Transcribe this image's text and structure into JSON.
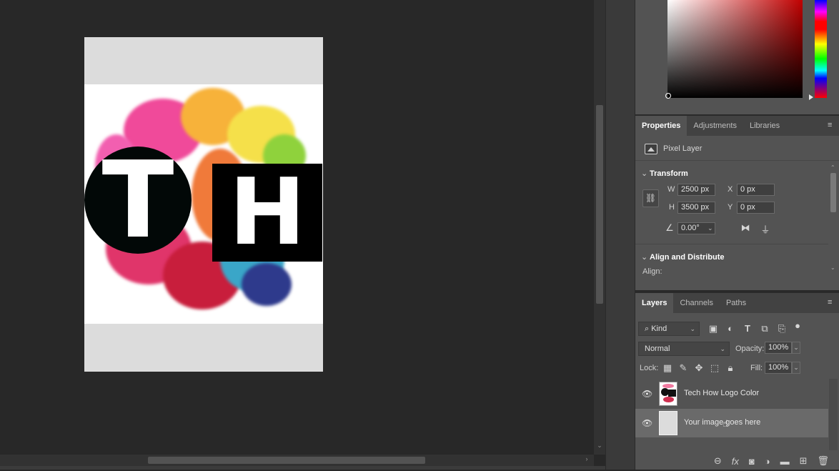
{
  "properties_panel": {
    "tabs": [
      {
        "label": "Properties",
        "active": true
      },
      {
        "label": "Adjustments",
        "active": false
      },
      {
        "label": "Libraries",
        "active": false
      }
    ],
    "layer_type": "Pixel Layer",
    "transform": {
      "title": "Transform",
      "w_label": "W",
      "w_value": "2500 px",
      "h_label": "H",
      "h_value": "3500 px",
      "x_label": "X",
      "x_value": "0 px",
      "y_label": "Y",
      "y_value": "0 px",
      "angle_value": "0.00°"
    },
    "align": {
      "title": "Align and Distribute",
      "align_label": "Align:"
    }
  },
  "layers_panel": {
    "tabs": [
      {
        "label": "Layers",
        "active": true
      },
      {
        "label": "Channels",
        "active": false
      },
      {
        "label": "Paths",
        "active": false
      }
    ],
    "filter_kind": "Kind",
    "blend_mode": "Normal",
    "opacity_label": "Opacity:",
    "opacity_value": "100%",
    "lock_label": "Lock:",
    "fill_label": "Fill:",
    "fill_value": "100%",
    "layers": [
      {
        "name": "Tech How Logo Color",
        "visible": true,
        "selected": false
      },
      {
        "name": "Your image goes here",
        "visible": true,
        "selected": true
      }
    ]
  },
  "document": {
    "logo_letter_left": "T",
    "logo_letter_right": "H"
  },
  "colors": {
    "canvas_bg": "#282828",
    "panel_bg": "#535353",
    "selected_layer": "#6a6a6a",
    "doc_bg": "#dcdcdc"
  },
  "icons": {
    "filter_icons": [
      "image-filter-icon",
      "adjustment-filter-icon",
      "type-filter-icon",
      "shape-filter-icon",
      "smart-object-filter-icon",
      "filter-toggle-icon"
    ],
    "lock_icons": [
      "lock-transparent-icon",
      "lock-image-icon",
      "lock-position-icon",
      "lock-artboard-icon",
      "lock-all-icon"
    ],
    "footer_icons": [
      "link-layers-icon",
      "fx-icon",
      "add-mask-icon",
      "new-adjustment-icon",
      "new-group-icon",
      "new-layer-icon",
      "delete-layer-icon"
    ]
  }
}
